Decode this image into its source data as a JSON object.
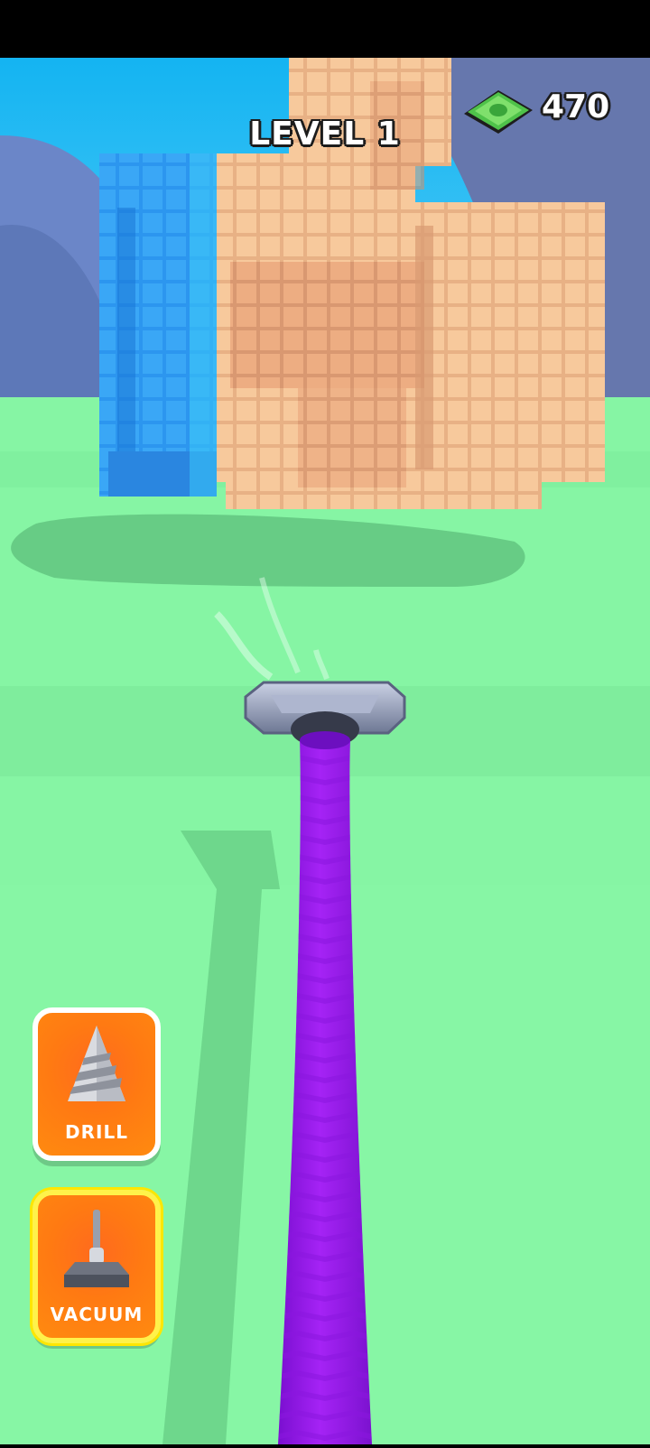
{
  "hud": {
    "level_label": "LEVEL 1",
    "currency_amount": "470",
    "currency_icon": "cash-bill-icon"
  },
  "tools": [
    {
      "name": "drill",
      "label": "DRILL",
      "icon": "drill-icon",
      "selected": false
    },
    {
      "name": "vacuum",
      "label": "VACUUM",
      "icon": "vacuum-icon",
      "selected": true
    }
  ],
  "colors": {
    "sky": "#1fb8f0",
    "ground": "#86f5a4",
    "statue_blue": "#2c96ef",
    "statue_skin": "#f7c79a",
    "hose": "#9b19ee",
    "button_orange": "#ff7a12",
    "selected_border": "#fff24a"
  }
}
